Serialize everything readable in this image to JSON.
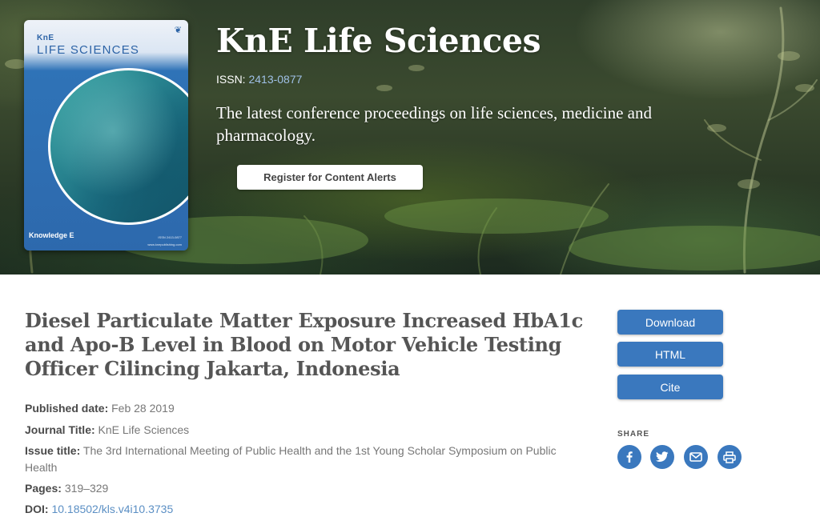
{
  "hero": {
    "journal_title": "KnE Life Sciences",
    "issn_label": "ISSN:",
    "issn_value": "2413-0877",
    "tagline": "The latest conference proceedings on life sciences, medicine and pharmacology.",
    "alert_button": "Register for Content Alerts",
    "cover": {
      "brand_top": "KnE",
      "brand_title": "LIFE SCIENCES",
      "publisher": "Knowledge E",
      "issn_small": "ISSN 2413-0877",
      "url_small": "www.knepublishing.com"
    }
  },
  "article": {
    "title": "Diesel Particulate Matter Exposure Increased HbA1c and Apo-B Level in Blood on Motor Vehicle Testing Officer Cilincing Jakarta, Indonesia",
    "meta": [
      {
        "label": "Published date:",
        "value": "Feb 28 2019"
      },
      {
        "label": "Journal Title:",
        "value": "KnE Life Sciences"
      },
      {
        "label": "Issue title:",
        "value": "The 3rd International Meeting of Public Health and the 1st Young Scholar Symposium on Public Health"
      },
      {
        "label": "Pages:",
        "value": "319–329"
      },
      {
        "label": "DOI:",
        "value": "10.18502/kls.v4i10.3735"
      }
    ]
  },
  "actions": {
    "download": "Download",
    "html": "HTML",
    "cite": "Cite"
  },
  "share": {
    "label": "SHARE",
    "icons": [
      "facebook-icon",
      "twitter-icon",
      "email-icon",
      "print-icon"
    ]
  },
  "colors": {
    "accent": "#3a78be",
    "link": "#5b8fc4",
    "title_text": "#555555"
  }
}
